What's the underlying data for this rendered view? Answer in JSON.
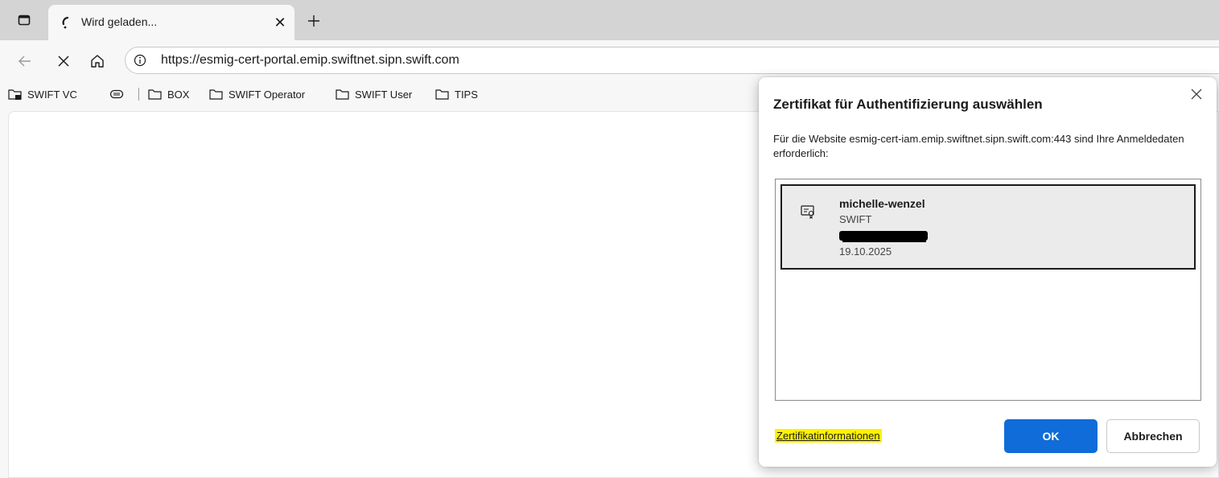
{
  "tab": {
    "title": "Wird geladen...",
    "close_icon": "close-icon",
    "new_tab_icon": "plus-icon"
  },
  "toolbar": {
    "url": "https://esmig-cert-portal.emip.swiftnet.sipn.swift.com"
  },
  "bookmarks": [
    {
      "label": "SWIFT VC",
      "icon": "folder-lock-icon"
    },
    {
      "label": "",
      "icon": "pill-icon"
    },
    {
      "label": "BOX",
      "icon": "folder-icon"
    },
    {
      "label": "SWIFT Operator",
      "icon": "folder-icon"
    },
    {
      "label": "SWIFT User",
      "icon": "folder-icon"
    },
    {
      "label": "TIPS",
      "icon": "folder-icon"
    }
  ],
  "dialog": {
    "title": "Zertifikat für Authentifizierung auswählen",
    "description": "Für die Website esmig-cert-iam.emip.swiftnet.sipn.swift.com:443 sind Ihre Anmeldedaten erforderlich:",
    "certificate": {
      "name": "michelle-wenzel",
      "issuer": "SWIFT",
      "date": "19.10.2025"
    },
    "cert_info_link": "Zertifikatinformationen",
    "ok_label": "OK",
    "cancel_label": "Abbrechen"
  },
  "colors": {
    "accent": "#0f6cd8",
    "highlight": "#fff200"
  }
}
